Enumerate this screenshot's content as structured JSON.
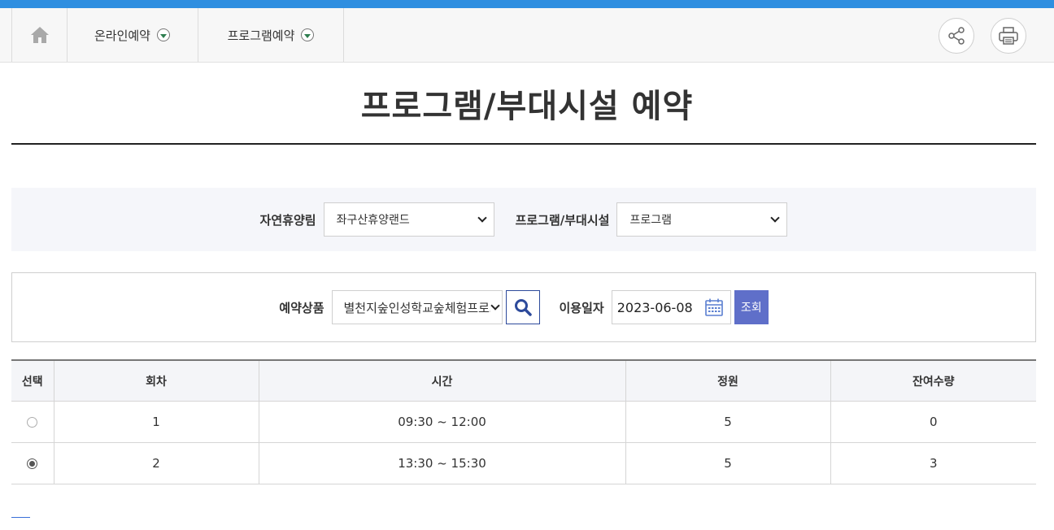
{
  "nav": {
    "home_icon": "home-icon",
    "menus": [
      {
        "label": "온라인예약"
      },
      {
        "label": "프로그램예약"
      }
    ],
    "share_icon": "share-icon",
    "print_icon": "print-icon"
  },
  "page": {
    "title": "프로그램/부대시설 예약"
  },
  "filter": {
    "forest_label": "자연휴양림",
    "forest_value": "좌구산휴양랜드",
    "type_label": "프로그램/부대시설",
    "type_value": "프로그램"
  },
  "search": {
    "product_label": "예약상품",
    "product_value": "별천지숲인성학교숲체험프로그램",
    "date_label": "이용일자",
    "date_value": "2023-06-08",
    "submit_label": "조회"
  },
  "table": {
    "headers": [
      "선택",
      "회차",
      "시간",
      "정원",
      "잔여수량"
    ],
    "rows": [
      {
        "selected": false,
        "round": "1",
        "time": "09:30 ~ 12:00",
        "capacity": "5",
        "remaining": "0"
      },
      {
        "selected": true,
        "round": "2",
        "time": "13:30 ~ 15:30",
        "capacity": "5",
        "remaining": "3"
      }
    ]
  },
  "colors": {
    "accent": "#2f8fe0",
    "button": "#5f6fc9",
    "search_border": "#2d4a9b"
  }
}
